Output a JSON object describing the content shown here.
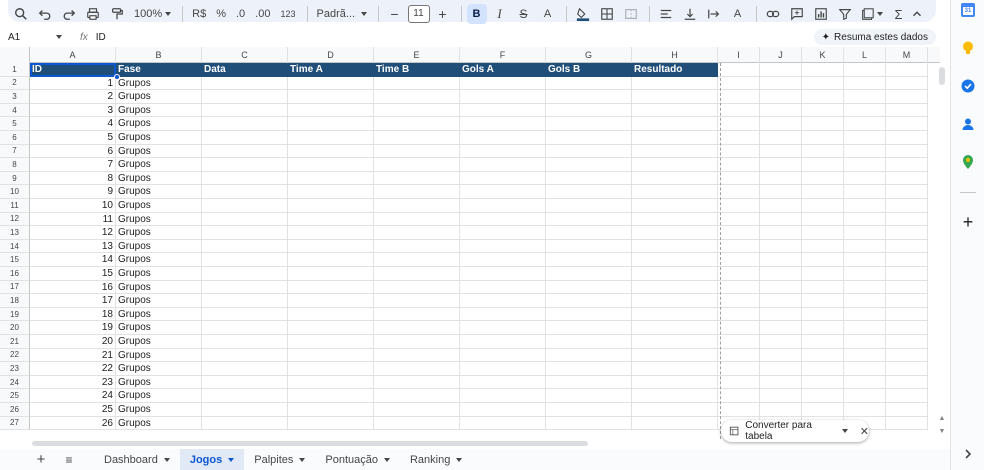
{
  "toolbar": {
    "zoom": "100%",
    "currency": "R$",
    "percent": "%",
    "dec_decrease": ".0",
    "dec_increase": ".00",
    "number_format": "123",
    "font_name": "Padrã...",
    "font_size": "11"
  },
  "formula": {
    "cell_ref": "A1",
    "fx": "fx",
    "content": "ID",
    "summarize_label": "Resuma estes dados"
  },
  "columns": [
    "A",
    "B",
    "C",
    "D",
    "E",
    "F",
    "G",
    "H",
    "I",
    "J",
    "K",
    "L",
    "M"
  ],
  "headers": [
    "ID",
    "Fase",
    "Data",
    "Time A",
    "Time B",
    "Gols A",
    "Gols B",
    "Resultado"
  ],
  "rows": [
    {
      "id": "1",
      "fase": "Grupos"
    },
    {
      "id": "2",
      "fase": "Grupos"
    },
    {
      "id": "3",
      "fase": "Grupos"
    },
    {
      "id": "4",
      "fase": "Grupos"
    },
    {
      "id": "5",
      "fase": "Grupos"
    },
    {
      "id": "6",
      "fase": "Grupos"
    },
    {
      "id": "7",
      "fase": "Grupos"
    },
    {
      "id": "8",
      "fase": "Grupos"
    },
    {
      "id": "9",
      "fase": "Grupos"
    },
    {
      "id": "10",
      "fase": "Grupos"
    },
    {
      "id": "11",
      "fase": "Grupos"
    },
    {
      "id": "12",
      "fase": "Grupos"
    },
    {
      "id": "13",
      "fase": "Grupos"
    },
    {
      "id": "14",
      "fase": "Grupos"
    },
    {
      "id": "15",
      "fase": "Grupos"
    },
    {
      "id": "16",
      "fase": "Grupos"
    },
    {
      "id": "17",
      "fase": "Grupos"
    },
    {
      "id": "18",
      "fase": "Grupos"
    },
    {
      "id": "19",
      "fase": "Grupos"
    },
    {
      "id": "20",
      "fase": "Grupos"
    },
    {
      "id": "21",
      "fase": "Grupos"
    },
    {
      "id": "22",
      "fase": "Grupos"
    },
    {
      "id": "23",
      "fase": "Grupos"
    },
    {
      "id": "24",
      "fase": "Grupos"
    },
    {
      "id": "25",
      "fase": "Grupos"
    },
    {
      "id": "26",
      "fase": "Grupos"
    }
  ],
  "convert_chip": {
    "label": "Converter para tabela"
  },
  "tabs": [
    {
      "label": "Dashboard",
      "active": false
    },
    {
      "label": "Jogos",
      "active": true
    },
    {
      "label": "Palpites",
      "active": false
    },
    {
      "label": "Pontuação",
      "active": false
    },
    {
      "label": "Ranking",
      "active": false
    }
  ],
  "side_panel": {
    "calendar_day": "31"
  },
  "colors": {
    "header_bg": "#1f4e79",
    "accent": "#0b57d0"
  }
}
